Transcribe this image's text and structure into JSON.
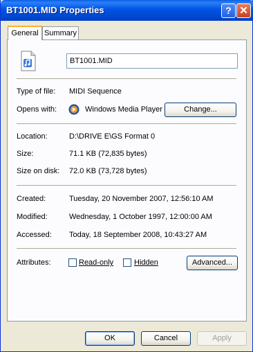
{
  "window": {
    "title": "BT1001.MID Properties"
  },
  "titlebar": {
    "help_glyph": "?",
    "close_glyph": "✕"
  },
  "tabs": [
    {
      "label": "General"
    },
    {
      "label": "Summary"
    }
  ],
  "file": {
    "name": "BT1001.MID"
  },
  "rows": {
    "type": {
      "label": "Type of file:",
      "value": "MIDI Sequence"
    },
    "opens": {
      "label": "Opens with:",
      "value": "Windows Media Player",
      "change_button": "Change..."
    },
    "location": {
      "label": "Location:",
      "value": "D:\\DRIVE E\\GS Format 0"
    },
    "size": {
      "label": "Size:",
      "value": "71.1 KB (72,835 bytes)"
    },
    "size_on_disk": {
      "label": "Size on disk:",
      "value": "72.0 KB (73,728 bytes)"
    },
    "created": {
      "label": "Created:",
      "value": "Tuesday, 20 November 2007, 12:56:10 AM"
    },
    "modified": {
      "label": "Modified:",
      "value": "Wednesday, 1 October 1997, 12:00:00 AM"
    },
    "accessed": {
      "label": "Accessed:",
      "value": "Today, 18 September 2008, 10:43:27 AM"
    }
  },
  "attributes": {
    "label": "Attributes:",
    "readonly": {
      "label": "Read-only",
      "checked": false
    },
    "hidden": {
      "label": "Hidden",
      "checked": false
    },
    "advanced_button": "Advanced..."
  },
  "footer": {
    "ok": "OK",
    "cancel": "Cancel",
    "apply": "Apply"
  },
  "icons": {
    "file": "midi-file-icon",
    "player": "windows-media-player-icon"
  }
}
